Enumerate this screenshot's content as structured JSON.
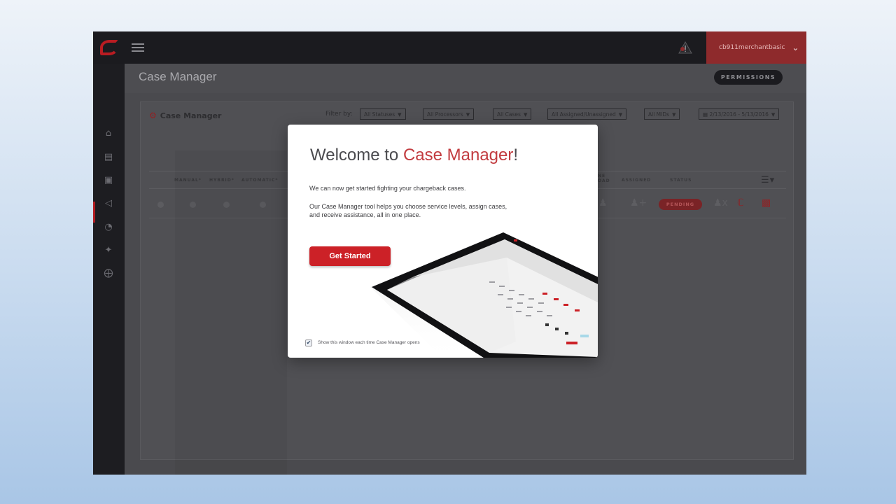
{
  "topbar": {
    "username": "cb911merchantbasic",
    "icons": [
      "logo-icon",
      "hamburger-menu-icon",
      "alert-notification-icon",
      "chevron-down-icon"
    ]
  },
  "sidebar": {
    "icons": [
      "home-icon",
      "bank-icon",
      "credit-card-icon",
      "megaphone-icon",
      "pie-chart-icon",
      "wrench-icon",
      "lifebuoy-icon"
    ],
    "active_index": 2
  },
  "page": {
    "title": "Case Manager",
    "permissions_label": "PERMISSIONS"
  },
  "panel": {
    "title": "Case Manager",
    "filter_label": "Filter by:",
    "filters": [
      "All Statuses",
      "All Processors",
      "All Cases",
      "All Assigned/Unassigned",
      "All MIDs",
      "2/13/2016 - 5/13/2016"
    ],
    "columns": [
      "MANUAL*",
      "HYBRID*",
      "AUTOMATIC*",
      "ASSIGNED",
      "STATUS"
    ],
    "column_fragment": "NE\nOAD",
    "row": {
      "status": "PENDING"
    }
  },
  "modal": {
    "title_prefix": "Welcome to ",
    "title_accent": "Case Manager",
    "title_suffix": "!",
    "paragraph1": "We can now get started fighting your chargeback cases.",
    "paragraph2": "Our Case Manager tool helps you choose service levels, assign cases, and receive assistance, all in one place.",
    "button_label": "Get Started",
    "checkbox_label": "Show this window each time Case Manager opens",
    "checkbox_checked": true
  },
  "colors": {
    "accent_red": "#cc2127",
    "topbar": "#1b1b1f",
    "user_menu": "#8e2a2c",
    "overlay": "#4a4a4e"
  }
}
